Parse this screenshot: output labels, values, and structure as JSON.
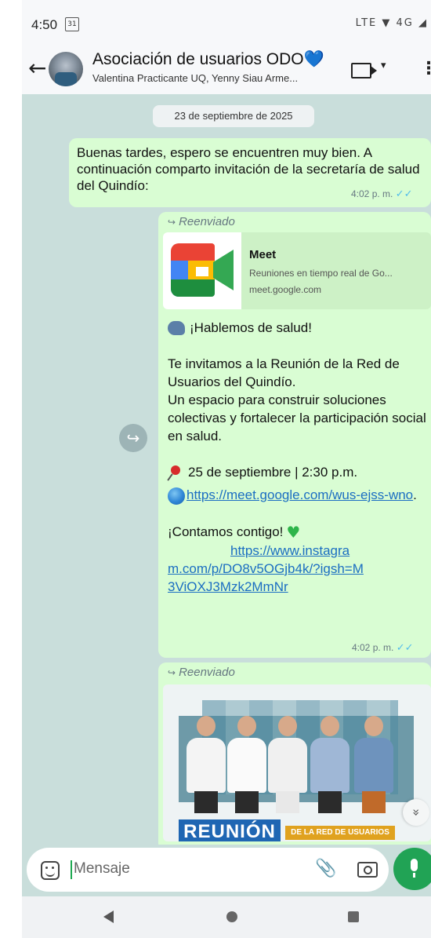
{
  "status_bar": {
    "time": "4:50",
    "calendar_day": "31",
    "icons": "LTE ▼ 4G ◢"
  },
  "header": {
    "back": "←",
    "title": "Asociación de usuarios ODO",
    "title_emoji": "💙",
    "subtitle": "Valentina Practicante UQ, Yenny Siau Arme...",
    "video_caret": "▾",
    "menu": "⋮"
  },
  "chat": {
    "date_chip": "23 de septiembre de 2025",
    "messages": [
      {
        "text": "Buenas tardes, espero se encuentren muy bien. A continuación comparto invitación de la secretaría de salud del Quindío:",
        "time": "4:02 p. m.",
        "ticks": "✓✓"
      },
      {
        "forwarded_label": "Reenviado",
        "link_preview": {
          "title": "Meet",
          "description": "Reuniones en tiempo real de Go...",
          "domain": "meet.google.com"
        },
        "line_headline": "¡Hablemos de salud!",
        "line_invite": "Te invitamos a la Reunión de la Red de Usuarios del Quindío.",
        "line_space": "Un espacio para construir soluciones colectivas y fortalecer la participación social en salud.",
        "line_date": "25 de septiembre | 2:30 p.m.",
        "meet_link": "https://meet.google.com/wus-ejss-wno",
        "meet_link_suffix": ".",
        "line_closing": "¡Contamos contigo!",
        "instagram_link": "https://www.instagram.com/p/DO8v5OGjb4k/?igsh=M3ViOXJ3Mzk2MmNr",
        "time": "4:02 p. m.",
        "ticks": "✓✓"
      },
      {
        "forwarded_label": "Reenviado",
        "image_banner": "REUNIÓN",
        "image_banner_sub": "DE LA RED DE USUARIOS"
      }
    ],
    "forward_button": "↪",
    "scroll_down": "»"
  },
  "composer": {
    "placeholder": "Mensaje",
    "clip": "📎"
  },
  "nav": {
    "back": "◀",
    "home": "●",
    "recent": "■"
  }
}
